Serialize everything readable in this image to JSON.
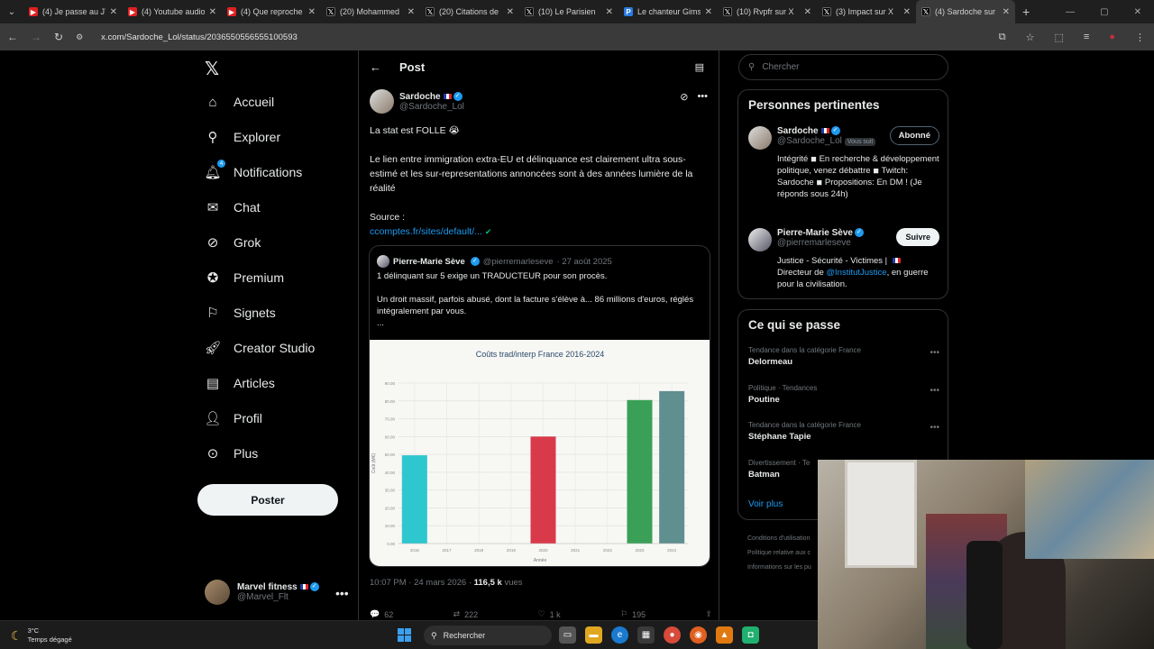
{
  "browser": {
    "tabs": [
      {
        "title": "(4) Je passe au JT",
        "kind": "yt"
      },
      {
        "title": "(4) Youtube audio",
        "kind": "yt"
      },
      {
        "title": "(4) Que reproche",
        "kind": "yt"
      },
      {
        "title": "(20) Mohammed",
        "kind": "x"
      },
      {
        "title": "(20) Citations de",
        "kind": "x"
      },
      {
        "title": "(10) Le Parisien",
        "kind": "x"
      },
      {
        "title": "Le chanteur Gims",
        "kind": "p"
      },
      {
        "title": "(10) Rvpfr sur X",
        "kind": "x"
      },
      {
        "title": "(3) Impact sur X",
        "kind": "x"
      },
      {
        "title": "(4) Sardoche sur",
        "kind": "x",
        "active": true
      }
    ],
    "url": "x.com/Sardoche_Lol/status/2036550556555100593"
  },
  "nav": {
    "logo": "𝕏",
    "items": [
      {
        "label": "Accueil",
        "icon": "home-icon"
      },
      {
        "label": "Explorer",
        "icon": "search-icon"
      },
      {
        "label": "Notifications",
        "icon": "bell-icon",
        "badge": "4"
      },
      {
        "label": "Chat",
        "icon": "mail-icon"
      },
      {
        "label": "Grok",
        "icon": "grok-icon"
      },
      {
        "label": "Premium",
        "icon": "premium-icon"
      },
      {
        "label": "Signets",
        "icon": "bookmark-icon"
      },
      {
        "label": "Creator Studio",
        "icon": "rocket-icon"
      },
      {
        "label": "Articles",
        "icon": "article-icon"
      },
      {
        "label": "Profil",
        "icon": "person-icon"
      },
      {
        "label": "Plus",
        "icon": "more-circle-icon"
      }
    ],
    "post_button": "Poster",
    "account": {
      "name": "Marvel fitness",
      "handle": "@Marvel_Flt"
    }
  },
  "post": {
    "header": "Post",
    "author": {
      "name": "Sardoche",
      "handle": "@Sardoche_Lol"
    },
    "text_1": "La stat est FOLLE 😭",
    "text_2": "Le lien entre immigration extra-EU et délinquance est clairement ultra sous-estimé et les sur-representations annoncées sont à des années lumière de la réalité",
    "source_label": "Source :",
    "source_link": "ccomptes.fr/sites/default/...",
    "quote": {
      "name": "Pierre-Marie Sève",
      "handle": "@pierremarleseve",
      "date": "· 27 août 2025",
      "text_1": "1 délinquant sur 5 exige un TRADUCTEUR pour son procès.",
      "text_2": "Un droit massif, parfois abusé, dont la facture s'élève à... 86 millions d'euros, réglés intégralement par vous.",
      "text_3": "..."
    },
    "time": "10:07 PM · 24 mars 2026 · ",
    "views": "116,5 k",
    "views_label": " vues",
    "actions": {
      "replies": "62",
      "reposts": "222",
      "likes": "1 k",
      "bookmarks": "195"
    }
  },
  "chart_data": {
    "type": "bar",
    "title": "Coûts trad/interp France 2016-2024",
    "xlabel": "Année",
    "ylabel": "Coût (M€)",
    "categories": [
      "2016",
      "2017",
      "2018",
      "2019",
      "2020",
      "2021",
      "2022",
      "2023",
      "2024"
    ],
    "values": [
      49.5,
      0,
      0,
      0,
      60,
      0,
      0,
      80.5,
      85.5
    ],
    "colors": [
      "#2ec7cf",
      "#2ec7cf",
      "#2ec7cf",
      "#2ec7cf",
      "#d93a4a",
      "#d93a4a",
      "#d93a4a",
      "#3aa058",
      "#5f8f8f"
    ],
    "ylim": [
      0,
      90
    ],
    "yticks": [
      "0.00",
      "10.00",
      "20.00",
      "30.00",
      "40.00",
      "50.00",
      "60.00",
      "70.00",
      "80.00",
      "90.00"
    ],
    "grid": true
  },
  "sidebar": {
    "search_placeholder": "Chercher",
    "relevant_title": "Personnes pertinentes",
    "people": [
      {
        "name": "Sardoche",
        "handle": "@Sardoche_Lol",
        "follows_you": "Vous suit",
        "button": "Abonné",
        "bio": "Intégrité ◾ En recherche & développement politique, venez débattre ◾ Twitch: Sardoche ◾ Propositions: En DM ! (Je réponds sous 24h)"
      },
      {
        "name": "Pierre-Marie Sève",
        "handle": "@pierremarleseve",
        "button": "Suivre",
        "bio_1": "Justice - Sécurité - Victimes | ",
        "bio_2": "Directeur de ",
        "bio_link": "@InstitutJustice",
        "bio_3": ", en guerre pour la civilisation."
      }
    ],
    "happening_title": "Ce qui se passe",
    "trends": [
      {
        "context": "Tendance dans la catégorie France",
        "name": "Delormeau"
      },
      {
        "context": "Politique · Tendances",
        "name": "Poutine"
      },
      {
        "context": "Tendance dans la catégorie France",
        "name": "Stéphane Tapie"
      },
      {
        "context": "Divertissement · Te",
        "name": "Batman"
      }
    ],
    "show_more": "Voir plus",
    "footer": [
      "Conditions d'utilisation",
      "Politique relative aux c",
      "Informations sur les pu"
    ]
  },
  "taskbar": {
    "temperature": "3°C",
    "weather": "Temps dégagé",
    "search": "Rechercher"
  }
}
